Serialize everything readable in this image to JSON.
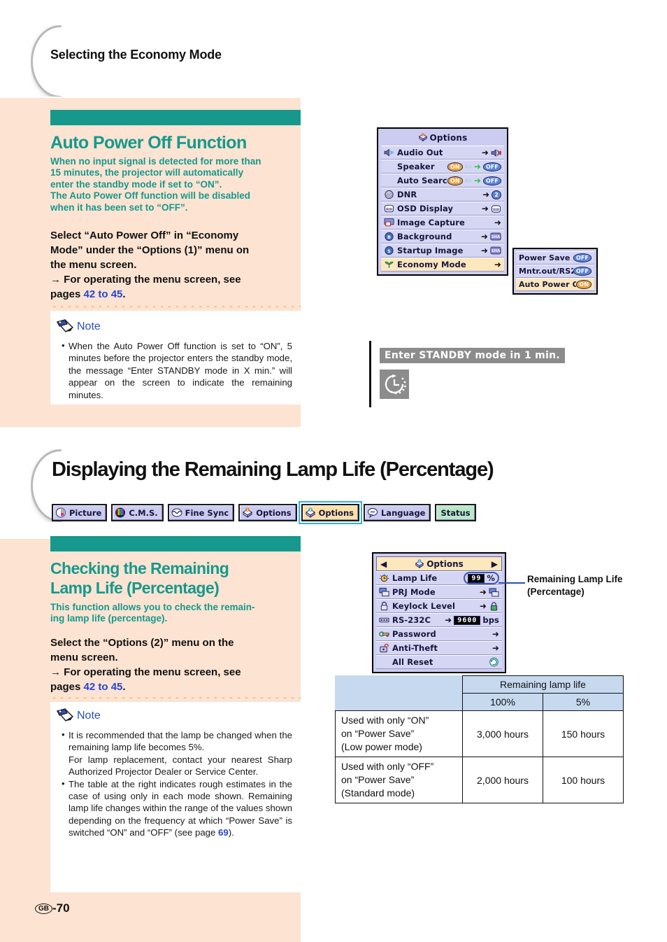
{
  "page": {
    "number_label": "GB",
    "number": "-70",
    "running_head": "Selecting the Economy Mode"
  },
  "section1": {
    "title": "Auto Power Off Function",
    "intro_lines": [
      "When no input signal is detected for more than",
      "15 minutes, the projector will automatically",
      "enter the standby mode if set to “ON”.",
      "The Auto Power Off function will be disabled",
      "when it has been set to “OFF”."
    ],
    "instruction_lines": [
      "Select “Auto Power Off” in “Economy",
      "Mode” under the “Options (1)” menu on",
      "the menu screen."
    ],
    "arrow_line_pre": "→ For operating the menu screen, see",
    "arrow_line_post_pre": "pages ",
    "arrow_page_ref": "42 to 45",
    "arrow_line_post_end": ".",
    "note_title": "Note",
    "note_items": [
      "When the Auto Power Off function is set to “ON”, 5 minutes before the projector enters the standby mode, the message “Enter STANDBY mode in X min.” will appear on the screen to indicate the remaining minutes."
    ]
  },
  "osd_options1": {
    "title": "Options",
    "title_icon": "options-1-icon",
    "rows": [
      {
        "label": "Audio Out",
        "icon": "audio-out-icon",
        "control": "arrow-speaker",
        "selected": false
      },
      {
        "label": "Speaker",
        "icon": "none",
        "control": "on-off-toggle",
        "on_label": "ON",
        "off_label": "OFF",
        "selected": false
      },
      {
        "label": "Auto Search",
        "icon": "none",
        "control": "on-off-toggle",
        "on_label": "ON",
        "off_label": "OFF",
        "selected": false
      },
      {
        "label": "DNR",
        "icon": "dnr-icon",
        "control": "arrow-value",
        "value": "2",
        "selected": false
      },
      {
        "label": "OSD Display",
        "icon": "osd-display-icon",
        "control": "arrow-icon",
        "selected": false
      },
      {
        "label": "Image Capture",
        "icon": "image-capture-icon",
        "control": "arrow-only",
        "selected": false
      },
      {
        "label": "Background",
        "icon": "background-icon",
        "control": "arrow-icon",
        "selected": false
      },
      {
        "label": "Startup Image",
        "icon": "startup-image-icon",
        "control": "arrow-icon",
        "selected": false
      },
      {
        "label": "Economy Mode",
        "icon": "economy-mode-icon",
        "control": "arrow-only",
        "selected": true
      }
    ]
  },
  "osd_economy_submenu": {
    "rows": [
      {
        "label": "Power Save",
        "state": "OFF",
        "selected": false
      },
      {
        "label": "Mntr.out/RS232",
        "state": "OFF",
        "selected": false
      },
      {
        "label": "Auto Power Off",
        "state": "ON",
        "selected": true
      }
    ]
  },
  "standby": {
    "message": "Enter STANDBY mode in 1 min.",
    "icon": "standby-timer-icon"
  },
  "section2": {
    "heading": "Displaying the Remaining Lamp Life (Percentage)",
    "title_line1": "Checking the Remaining",
    "title_line2": "Lamp Life (Percentage)",
    "intro_lines": [
      "This function allows you to check the remain-",
      "ing lamp life (percentage)."
    ],
    "instruction_lines": [
      "Select the “Options (2)” menu on the",
      "menu screen."
    ],
    "arrow_line_pre": "→ For operating the menu screen, see",
    "arrow_line_post_pre": "pages ",
    "arrow_page_ref": "42 to 45",
    "arrow_line_post_end": ".",
    "note_title": "Note",
    "note_item1_a": "It is recommended that the lamp be changed when the remaining lamp life becomes 5%.",
    "note_item1_b": "For lamp replacement, contact your nearest Sharp Authorized Projector Dealer or Service Center.",
    "note_item2_pre": "The table at the right indicates rough estimates in the case of using only in each mode shown. Remaining lamp life changes within the range of the values shown depending on the frequency at which “Power Save” is switched “ON” and “OFF” (see page ",
    "note_item2_ref": "69",
    "note_item2_post": ")."
  },
  "tabstrip": {
    "tabs": [
      {
        "label": "Picture",
        "icon": "picture-icon",
        "selected": false
      },
      {
        "label": "C.M.S.",
        "icon": "cms-icon",
        "selected": false
      },
      {
        "label": "Fine Sync",
        "icon": "fine-sync-icon",
        "selected": false
      },
      {
        "label": "Options",
        "icon": "options-1-icon",
        "selected": false
      },
      {
        "label": "Options",
        "icon": "options-2-icon",
        "selected": true
      },
      {
        "label": "Language",
        "icon": "language-icon",
        "selected": false
      },
      {
        "label": "Status",
        "icon": "none",
        "selected": false
      }
    ]
  },
  "osd_options2": {
    "title": "Options",
    "title_icon": "options-2-icon",
    "left_arrow": "◀",
    "right_arrow": "▶",
    "rows": [
      {
        "label": "Lamp Life",
        "icon": "lamp-life-icon",
        "control": "value-pct",
        "value": "99",
        "unit": "%"
      },
      {
        "label": "PRJ Mode",
        "icon": "prj-mode-icon",
        "control": "arrow-icon"
      },
      {
        "label": "Keylock Level",
        "icon": "keylock-icon",
        "control": "arrow-icon"
      },
      {
        "label": "RS-232C",
        "icon": "rs232c-icon",
        "control": "arrow-value-unit",
        "value": "9600",
        "unit": "bps"
      },
      {
        "label": "Password",
        "icon": "password-icon",
        "control": "arrow-only"
      },
      {
        "label": "Anti-Theft",
        "icon": "anti-theft-icon",
        "control": "arrow-only"
      },
      {
        "label": "All Reset",
        "icon": "none",
        "control": "reset-icon"
      }
    ]
  },
  "callout": {
    "line1": "Remaining Lamp Life",
    "line2": "(Percentage)"
  },
  "lamp_table": {
    "header_span": "Remaining lamp life",
    "sub_headers": [
      "100%",
      "5%"
    ],
    "rows": [
      {
        "mode_lines": [
          "Used with only “ON”",
          "on “Power Save”",
          "(Low power mode)"
        ],
        "full": "3,000 hours",
        "low": "150 hours"
      },
      {
        "mode_lines": [
          "Used with only “OFF”",
          "on “Power Save”",
          "(Standard mode)"
        ],
        "full": "2,000 hours",
        "low": "100 hours"
      }
    ]
  },
  "colors": {
    "teal": "#16998c",
    "peach": "#fce3d2",
    "blue_link": "#2346d6",
    "note_blue": "#2b4fb8",
    "osd_bg": "#ccccf0",
    "osd_sel": "#fde7bd",
    "tab_sel_border": "#29b6e8",
    "table_header": "#c6d9ef"
  }
}
